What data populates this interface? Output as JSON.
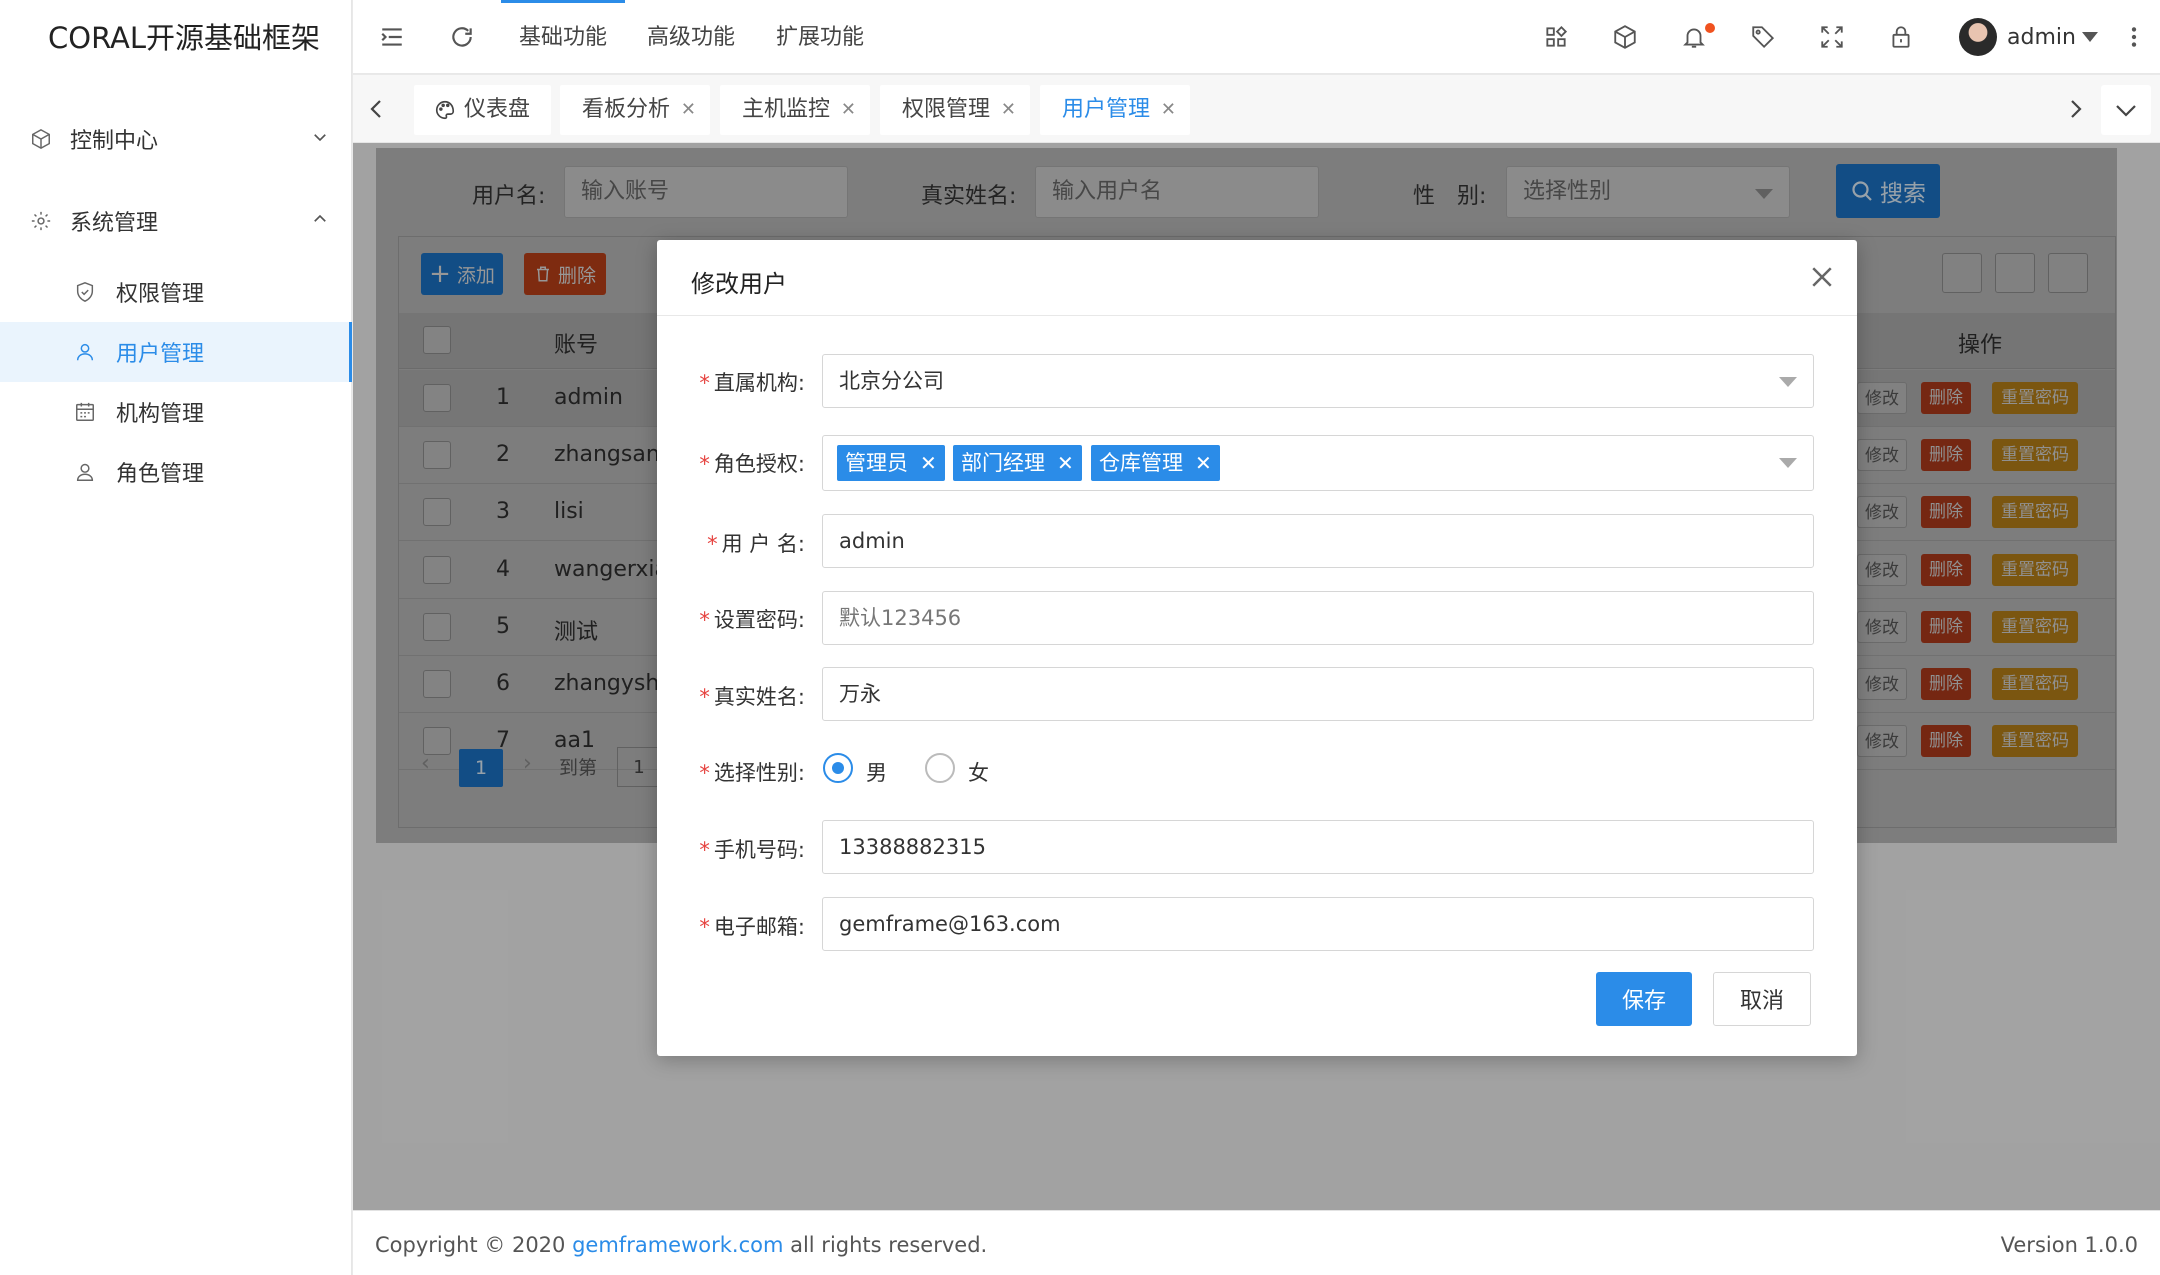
{
  "app": {
    "brand": "CORAL开源基础框架"
  },
  "sidebar": {
    "groups": [
      {
        "label": "控制中心"
      },
      {
        "label": "系统管理"
      }
    ],
    "items": [
      {
        "label": "权限管理"
      },
      {
        "label": "用户管理"
      },
      {
        "label": "机构管理"
      },
      {
        "label": "角色管理"
      }
    ]
  },
  "topbar": {
    "nav": [
      "基础功能",
      "高级功能",
      "扩展功能"
    ],
    "user": "admin"
  },
  "tabs": [
    "仪表盘",
    "看板分析",
    "主机监控",
    "权限管理",
    "用户管理"
  ],
  "filter": {
    "username_label": "用户名:",
    "username_placeholder": "输入账号",
    "realname_label": "真实姓名:",
    "realname_placeholder": "输入用户名",
    "gender_label": "性　别:",
    "gender_placeholder": "选择性别",
    "search_label": "搜索"
  },
  "table": {
    "add_label": "添加",
    "delete_label": "删除",
    "col_account": "账号",
    "col_ops": "操作",
    "rows": [
      {
        "no": "1",
        "account": "admin"
      },
      {
        "no": "2",
        "account": "zhangsan"
      },
      {
        "no": "3",
        "account": "lisi"
      },
      {
        "no": "4",
        "account": "wangerxiao"
      },
      {
        "no": "5",
        "account": "测试"
      },
      {
        "no": "6",
        "account": "zhangysh"
      },
      {
        "no": "7",
        "account": "aa1"
      }
    ],
    "op_edit": "修改",
    "op_delete": "删除",
    "op_reset": "重置密码",
    "pager_current": "1",
    "pager_goto": "到第",
    "pager_input": "1"
  },
  "modal": {
    "title": "修改用户",
    "fields": {
      "org_label": "直属机构:",
      "org_value": "北京分公司",
      "roles_label": "角色授权:",
      "roles": [
        "管理员",
        "部门经理",
        "仓库管理"
      ],
      "username_label": "用 户 名:",
      "username_value": "admin",
      "password_label": "设置密码:",
      "password_placeholder": "默认123456",
      "realname_label": "真实姓名:",
      "realname_value": "万永",
      "gender_label": "选择性别:",
      "gender_male": "男",
      "gender_female": "女",
      "phone_label": "手机号码:",
      "phone_value": "13388882315",
      "email_label": "电子邮箱:",
      "email_value": "gemframe@163.com"
    },
    "save_label": "保存",
    "cancel_label": "取消"
  },
  "footer": {
    "copy_prefix": "Copyright © 2020 ",
    "copy_link": "gemframework.com",
    "copy_suffix": " all rights reserved.",
    "version": "Version 1.0.0"
  },
  "colors": {
    "accent": "#2b8ce8",
    "danger": "#f0521f",
    "warning": "#f5a623"
  }
}
